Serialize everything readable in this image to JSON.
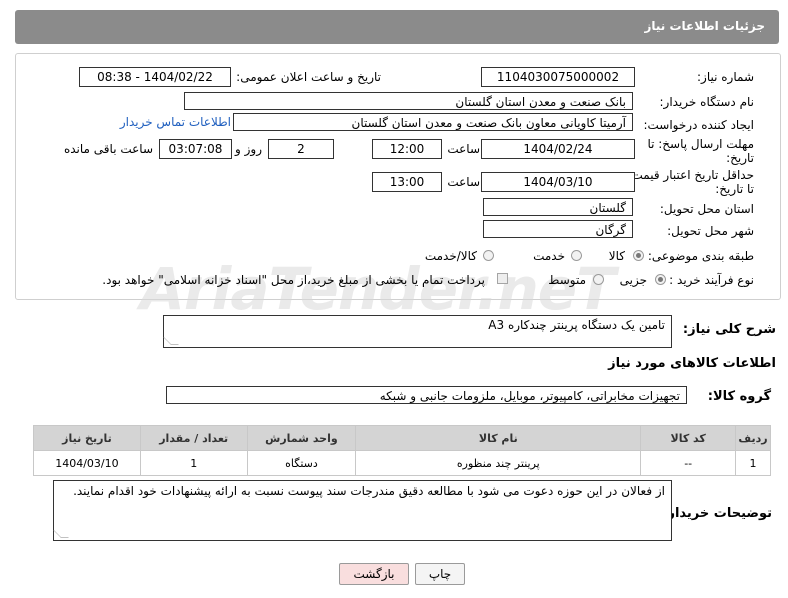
{
  "header": {
    "title": "جزئیات اطلاعات نیاز"
  },
  "watermark": "AriaTender.neT",
  "form": {
    "need_number_label": "شماره نیاز:",
    "need_number": "1104030075000002",
    "announce_label": "تاریخ و ساعت اعلان عمومی:",
    "announce_value": "1404/02/22 - 08:38",
    "buyer_org_label": "نام دستگاه خریدار:",
    "buyer_org": "بانک صنعت و معدن استان گلستان",
    "creator_label": "ایجاد کننده درخواست:",
    "creator": "آرمیتا کاویانی معاون بانک صنعت و معدن استان گلستان",
    "contact_link": "اطلاعات تماس خریدار",
    "deadline_label_1": "مهلت ارسال پاسخ: تا",
    "deadline_label_2": "تاریخ:",
    "deadline_date": "1404/02/24",
    "time_label": "ساعت",
    "deadline_time": "12:00",
    "days_value": "2",
    "days_label": "روز و",
    "remaining_time": "03:07:08",
    "remaining_label": "ساعت باقی مانده",
    "validity_label_1": "حداقل تاریخ اعتبار قیمت:",
    "validity_label_2": "تا تاریخ:",
    "validity_date": "1404/03/10",
    "validity_time": "13:00",
    "province_label": "استان محل تحویل:",
    "province": "گلستان",
    "city_label": "شهر محل تحویل:",
    "city": "گرگان",
    "category_label": "طبقه بندی موضوعی:",
    "category_options": [
      "کالا",
      "خدمت",
      "کالا/خدمت"
    ],
    "category_selected": "کالا",
    "process_label": "نوع فرآیند خرید :",
    "process_options": [
      "جزیی",
      "متوسط"
    ],
    "process_selected": "جزیی",
    "payment_note": "پرداخت تمام یا بخشی از مبلغ خرید،از محل \"اسناد خزانه اسلامی\" خواهد بود."
  },
  "description": {
    "label": "شرح کلی نیاز:",
    "value": "تامین یک دستگاه پرینتر چندکاره A3"
  },
  "goods_info": {
    "title": "اطلاعات کالاهای مورد نیاز",
    "group_label": "گروه کالا:",
    "group_value": "تجهیزات مخابراتی، کامپیوتر، موبایل، ملزومات جانبی و شبکه",
    "columns": [
      "ردیف",
      "کد کالا",
      "نام کالا",
      "واحد شمارش",
      "تعداد / مقدار",
      "تاریخ نیاز"
    ],
    "rows": [
      [
        "1",
        "--",
        "پرینتر چند منظوره",
        "دستگاه",
        "1",
        "1404/03/10"
      ]
    ]
  },
  "buyer_notes": {
    "label": "توضیحات خریدار:",
    "value": "از فعالان در این حوزه دعوت می شود با مطالعه دقیق مندرجات سند پیوست نسبت به ارائه پیشنهادات خود اقدام نمایند."
  },
  "buttons": {
    "print": "چاپ",
    "back": "بازگشت"
  },
  "colors": {
    "header_bg": "#8b8b8b",
    "link": "#1f5fbf",
    "back_button_bg": "#f9dede"
  }
}
